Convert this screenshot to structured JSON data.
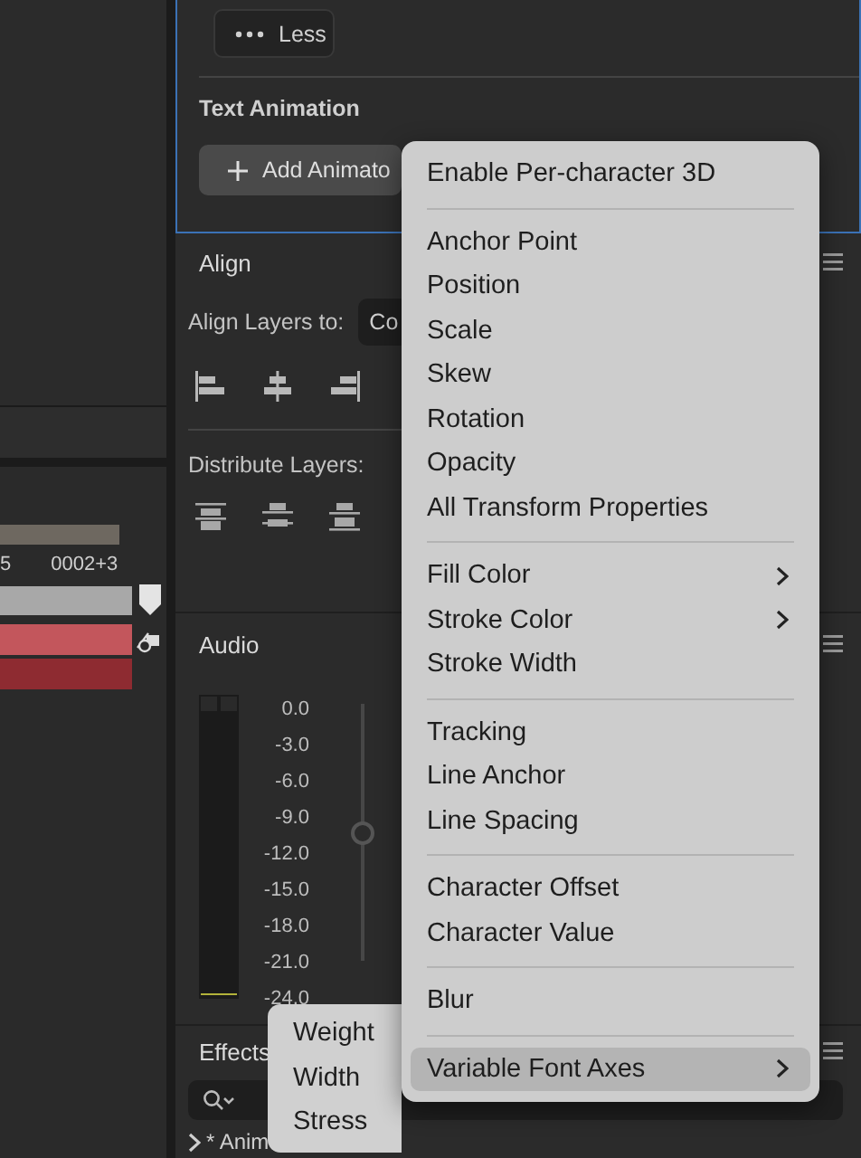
{
  "timeline": {
    "ruler_labels": [
      "5",
      "0002+3"
    ]
  },
  "text_panel": {
    "less_button": "Less",
    "section_title": "Text Animation",
    "add_animator_button": "Add Animato"
  },
  "align_panel": {
    "title": "Align",
    "align_layers_label": "Align Layers to:",
    "align_to_value": "Co",
    "distribute_label": "Distribute Layers:"
  },
  "audio_panel": {
    "title": "Audio",
    "meter_labels": [
      "0.0",
      "-3.0",
      "-6.0",
      "-9.0",
      "-12.0",
      "-15.0",
      "-18.0",
      "-21.0",
      "-24.0"
    ],
    "level": 0.5
  },
  "effects_panel": {
    "title": "Effects",
    "tree_item": "* Anim"
  },
  "context_menu": {
    "groups": [
      [
        {
          "label": "Enable Per-character 3D",
          "has_submenu": false,
          "selected": false
        }
      ],
      [
        {
          "label": "Anchor Point",
          "has_submenu": false,
          "selected": false
        },
        {
          "label": "Position",
          "has_submenu": false,
          "selected": false
        },
        {
          "label": "Scale",
          "has_submenu": false,
          "selected": false
        },
        {
          "label": "Skew",
          "has_submenu": false,
          "selected": false
        },
        {
          "label": "Rotation",
          "has_submenu": false,
          "selected": false
        },
        {
          "label": "Opacity",
          "has_submenu": false,
          "selected": false
        },
        {
          "label": "All Transform Properties",
          "has_submenu": false,
          "selected": false
        }
      ],
      [
        {
          "label": "Fill Color",
          "has_submenu": true,
          "selected": false
        },
        {
          "label": "Stroke Color",
          "has_submenu": true,
          "selected": false
        },
        {
          "label": "Stroke Width",
          "has_submenu": false,
          "selected": false
        }
      ],
      [
        {
          "label": "Tracking",
          "has_submenu": false,
          "selected": false
        },
        {
          "label": "Line Anchor",
          "has_submenu": false,
          "selected": false
        },
        {
          "label": "Line Spacing",
          "has_submenu": false,
          "selected": false
        }
      ],
      [
        {
          "label": "Character Offset",
          "has_submenu": false,
          "selected": false
        },
        {
          "label": "Character Value",
          "has_submenu": false,
          "selected": false
        }
      ],
      [
        {
          "label": "Blur",
          "has_submenu": false,
          "selected": false
        }
      ],
      [
        {
          "label": "Variable Font Axes",
          "has_submenu": true,
          "selected": true
        }
      ]
    ]
  },
  "submenu": {
    "items": [
      "Weight",
      "Width",
      "Stress"
    ]
  }
}
